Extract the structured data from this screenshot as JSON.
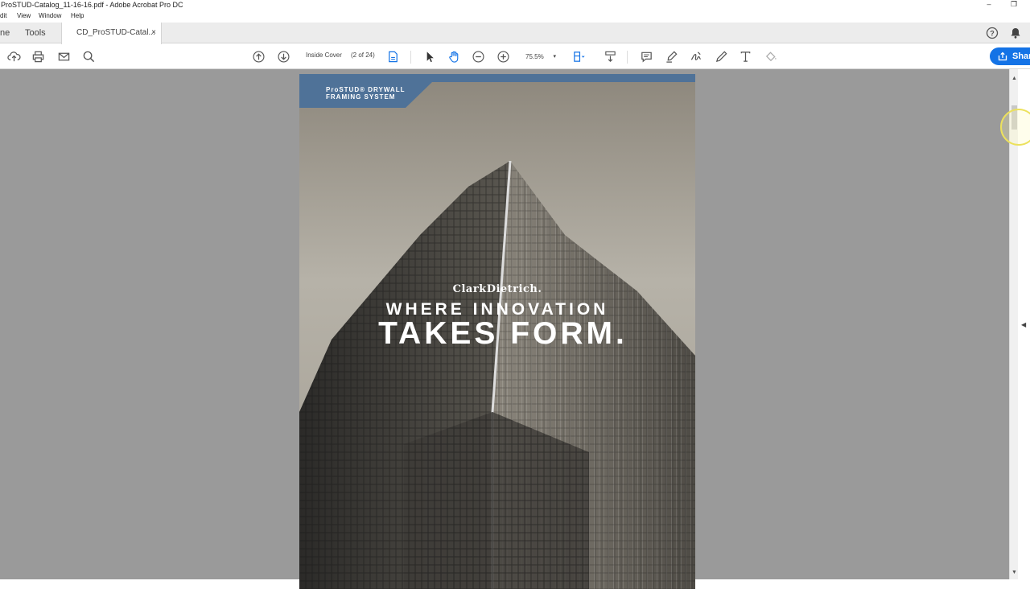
{
  "window": {
    "title": "ProSTUD-Catalog_11-16-16.pdf - Adobe Acrobat Pro DC",
    "minimize": "–",
    "restore": "❐"
  },
  "menu": {
    "items": [
      "dit",
      "View",
      "Window",
      "Help"
    ]
  },
  "tabs": {
    "home": "ne",
    "tools": "Tools",
    "document": "CD_ProSTUD-Catal...",
    "close": "×"
  },
  "toolbar": {
    "page_label": "Inside Cover",
    "page_count": "(2 of 24)",
    "zoom": "75.5%",
    "zoom_caret": "▾",
    "share_label": "Shar"
  },
  "document": {
    "banner_line1": "ProSTUD® DRYWALL",
    "banner_line2": "FRAMING SYSTEM",
    "brand": "ClarkDietrich.",
    "tagline_1": "WHERE INNOVATION",
    "tagline_2": "TAKES FORM."
  },
  "colors": {
    "accent": "#1473e6",
    "banner": "#4f7298",
    "doc_background": "#9a9a9a"
  }
}
